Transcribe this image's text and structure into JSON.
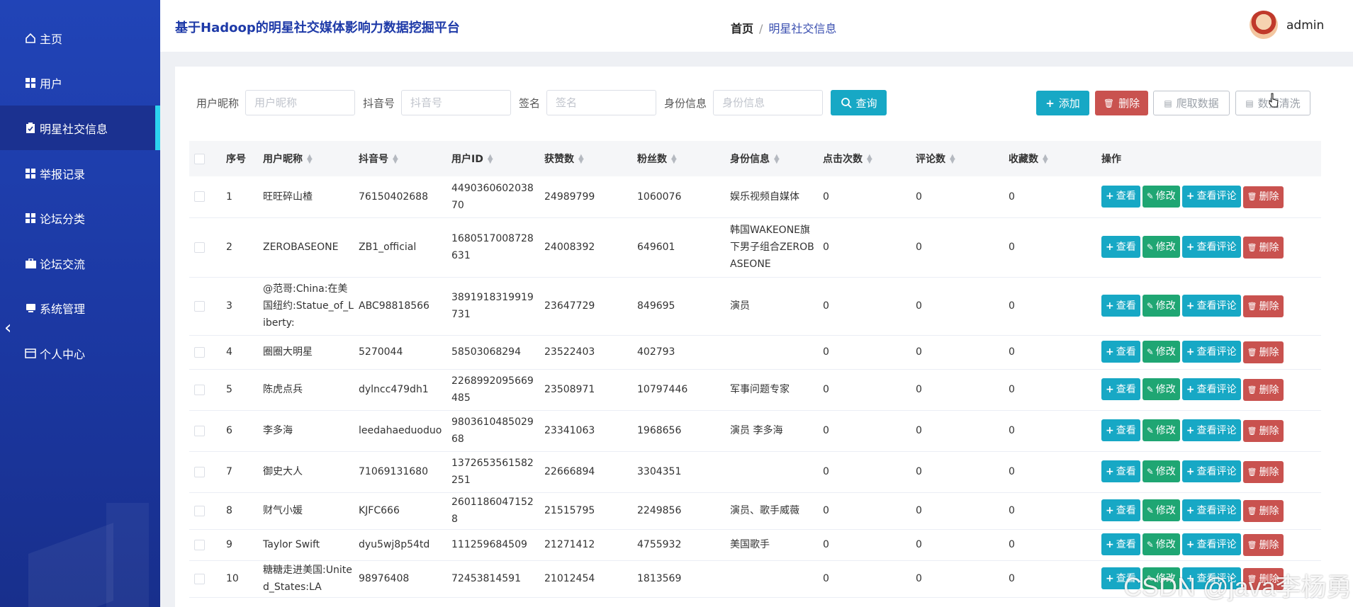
{
  "app": {
    "title": "基于Hadoop的明星社交媒体影响力数据挖掘平台"
  },
  "breadcrumb": {
    "home": "首页",
    "separator": "/",
    "current": "明星社交信息"
  },
  "user": {
    "name": "admin"
  },
  "sidebar": {
    "items": [
      {
        "label": "主页",
        "icon": "home-icon"
      },
      {
        "label": "用户",
        "icon": "grid-icon"
      },
      {
        "label": "明星社交信息",
        "icon": "clipboard-icon",
        "active": true
      },
      {
        "label": "举报记录",
        "icon": "grid-icon"
      },
      {
        "label": "论坛分类",
        "icon": "grid-icon"
      },
      {
        "label": "论坛交流",
        "icon": "briefcase-icon"
      },
      {
        "label": "系统管理",
        "icon": "monitor-icon"
      },
      {
        "label": "个人中心",
        "icon": "card-icon"
      }
    ]
  },
  "search": {
    "nickname_label": "用户昵称",
    "nickname_placeholder": "用户昵称",
    "douyin_label": "抖音号",
    "douyin_placeholder": "抖音号",
    "signature_label": "签名",
    "signature_placeholder": "签名",
    "identity_label": "身份信息",
    "identity_placeholder": "身份信息",
    "query_label": "查询"
  },
  "toolbar": {
    "add_label": "添加",
    "delete_label": "删除",
    "crawl_label": "爬取数据",
    "clean_label": "数据清洗"
  },
  "table": {
    "headers": [
      "序号",
      "用户昵称",
      "抖音号",
      "用户ID",
      "获赞数",
      "粉丝数",
      "身份信息",
      "点击次数",
      "评论数",
      "收藏数",
      "操作"
    ],
    "actions": {
      "view": "查看",
      "edit": "修改",
      "view_comments": "查看评论",
      "delete": "删除"
    },
    "rows": [
      {
        "idx": "1",
        "nickname": "旺旺碎山楂",
        "douyin": "76150402688",
        "uid": "449036060203870",
        "likes": "24989799",
        "fans": "1060076",
        "identity": "娱乐视频自媒体",
        "clicks": "0",
        "comments": "0",
        "favorites": "0"
      },
      {
        "idx": "2",
        "nickname": "ZEROBASEONE",
        "douyin": "ZB1_official",
        "uid": "1680517008728631",
        "likes": "24008392",
        "fans": "649601",
        "identity": "韩国WAKEONE旗下男子组合ZEROBASEONE",
        "clicks": "0",
        "comments": "0",
        "favorites": "0"
      },
      {
        "idx": "3",
        "nickname": "@范哥:China:在美国纽约:Statue_of_Liberty:",
        "douyin": "ABC98818566",
        "uid": "3891918319919731",
        "likes": "23647729",
        "fans": "849695",
        "identity": "演员",
        "clicks": "0",
        "comments": "0",
        "favorites": "0"
      },
      {
        "idx": "4",
        "nickname": "圈圈大明星",
        "douyin": "5270044",
        "uid": "58503068294",
        "likes": "23522403",
        "fans": "402793",
        "identity": "",
        "clicks": "0",
        "comments": "0",
        "favorites": "0"
      },
      {
        "idx": "5",
        "nickname": "陈虎点兵",
        "douyin": "dylncc479dh1",
        "uid": "2268992095669485",
        "likes": "23508971",
        "fans": "10797446",
        "identity": "军事问题专家",
        "clicks": "0",
        "comments": "0",
        "favorites": "0"
      },
      {
        "idx": "6",
        "nickname": "李多海",
        "douyin": "leedahaeduoduo",
        "uid": "980361048502968",
        "likes": "23341063",
        "fans": "1968656",
        "identity": "演员 李多海",
        "clicks": "0",
        "comments": "0",
        "favorites": "0"
      },
      {
        "idx": "7",
        "nickname": "御史大人",
        "douyin": "71069131680",
        "uid": "1372653561582251",
        "likes": "22666894",
        "fans": "3304351",
        "identity": "",
        "clicks": "0",
        "comments": "0",
        "favorites": "0"
      },
      {
        "idx": "8",
        "nickname": "财气小媛",
        "douyin": "KJFC666",
        "uid": "26011860471528",
        "likes": "21515795",
        "fans": "2249856",
        "identity": "演员、歌手威薇",
        "clicks": "0",
        "comments": "0",
        "favorites": "0"
      },
      {
        "idx": "9",
        "nickname": "Taylor Swift",
        "douyin": "dyu5wj8p54td",
        "uid": "111259684509",
        "likes": "21271412",
        "fans": "4755932",
        "identity": "美国歌手",
        "clicks": "0",
        "comments": "0",
        "favorites": "0"
      },
      {
        "idx": "10",
        "nickname": "糖糖走进美国:United_States:LA",
        "douyin": "98976408",
        "uid": "72453814591",
        "likes": "21012454",
        "fans": "1813569",
        "identity": "",
        "clicks": "0",
        "comments": "0",
        "favorites": "0"
      }
    ]
  },
  "watermark": "CSDN @java李杨勇",
  "colors": {
    "sidebar": "#1e3aa8",
    "accent": "#17a8c5",
    "danger": "#c9524f",
    "success": "#1fa673"
  }
}
